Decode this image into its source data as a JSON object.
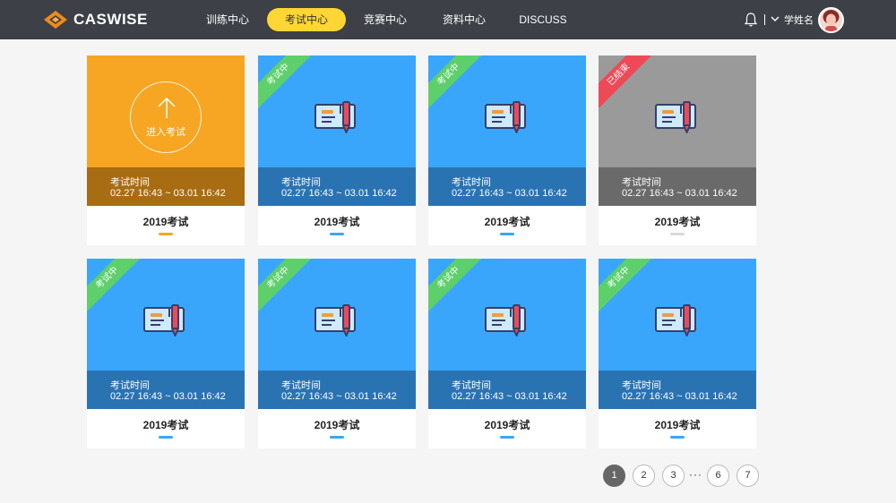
{
  "header": {
    "logo_text": "CASWISE",
    "nav": [
      {
        "label": "训练中心",
        "active": false
      },
      {
        "label": "考试中心",
        "active": true
      },
      {
        "label": "竞赛中心",
        "active": false
      },
      {
        "label": "资料中心",
        "active": false
      },
      {
        "label": "DISCUSS",
        "active": false
      }
    ],
    "divider_text": "|",
    "username": "学姓名",
    "icons": {
      "notification": "bell-icon",
      "dropdown": "chevron-down-icon",
      "avatar": "user-avatar"
    }
  },
  "colors": {
    "header_bg": "#3d4046",
    "nav_active": "#ffd633",
    "blue": "#3aa6fb",
    "blue_dark": "#2a73b3",
    "orange": "#f6a623",
    "orange_dark": "#a86c12",
    "gray": "#9a9a9a",
    "gray_dark": "#6a6a6a",
    "green_ribbon": "#5dd06b",
    "red_ribbon": "#ef4957"
  },
  "exams": [
    {
      "state": "enter",
      "enter_label": "进入考试",
      "time_label": "考试时间",
      "time_range": "02.27 16:43 ~ 03.01 16:42",
      "title": "2019考试"
    },
    {
      "state": "ongoing",
      "ribbon": "考试中",
      "time_label": "考试时间",
      "time_range": "02.27 16:43 ~ 03.01 16:42",
      "title": "2019考试"
    },
    {
      "state": "ongoing",
      "ribbon": "考试中",
      "time_label": "考试时间",
      "time_range": "02.27 16:43 ~ 03.01 16:42",
      "title": "2019考试"
    },
    {
      "state": "ended",
      "ribbon": "已结束",
      "time_label": "考试时间",
      "time_range": "02.27 16:43 ~ 03.01 16:42",
      "title": "2019考试"
    },
    {
      "state": "ongoing",
      "ribbon": "考试中",
      "time_label": "考试时间",
      "time_range": "02.27 16:43 ~ 03.01 16:42",
      "title": "2019考试"
    },
    {
      "state": "ongoing",
      "ribbon": "考试中",
      "time_label": "考试时间",
      "time_range": "02.27 16:43 ~ 03.01 16:42",
      "title": "2019考试"
    },
    {
      "state": "ongoing",
      "ribbon": "考试中",
      "time_label": "考试时间",
      "time_range": "02.27 16:43 ~ 03.01 16:42",
      "title": "2019考试"
    },
    {
      "state": "ongoing",
      "ribbon": "考试中",
      "time_label": "考试时间",
      "time_range": "02.27 16:43 ~ 03.01 16:42",
      "title": "2019考试"
    }
  ],
  "pagination": {
    "pages": [
      "1",
      "2",
      "3",
      "6",
      "7"
    ],
    "current": "1",
    "ellipsis": "···"
  }
}
